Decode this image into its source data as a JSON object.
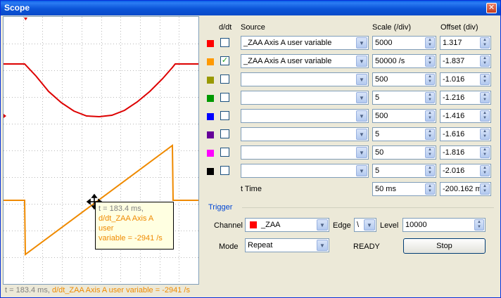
{
  "window": {
    "title": "Scope",
    "close_glyph": "✕"
  },
  "scope_tooltip": {
    "time": "t = 183.4 ms,",
    "value_line1": "d/dt_ZAA Axis A user",
    "value_line2": "variable = -2941 /s"
  },
  "status": {
    "time": "t = 183.4 ms,",
    "value": "d/dt_ZAA Axis A user variable = -2941 /s"
  },
  "headers": {
    "ddt": "d/dt",
    "source": "Source",
    "scale": "Scale (/div)",
    "offset": "Offset (div)"
  },
  "channels": [
    {
      "color": "#ff0000",
      "checked": false,
      "source": "_ZAA Axis A user variable",
      "scale": "5000",
      "offset": "1.317"
    },
    {
      "color": "#ff9900",
      "checked": true,
      "source": "_ZAA Axis A user variable",
      "scale": "50000 /s",
      "offset": "-1.837"
    },
    {
      "color": "#999900",
      "checked": false,
      "source": "",
      "scale": "500",
      "offset": "-1.016"
    },
    {
      "color": "#009900",
      "checked": false,
      "source": "",
      "scale": "5",
      "offset": "-1.216"
    },
    {
      "color": "#0000ff",
      "checked": false,
      "source": "",
      "scale": "500",
      "offset": "-1.416"
    },
    {
      "color": "#660099",
      "checked": false,
      "source": "",
      "scale": "5",
      "offset": "-1.616"
    },
    {
      "color": "#ff00ff",
      "checked": false,
      "source": "",
      "scale": "50",
      "offset": "-1.816"
    },
    {
      "color": "#000000",
      "checked": false,
      "source": "",
      "scale": "5",
      "offset": "-2.016"
    }
  ],
  "time_row": {
    "label": "t Time",
    "scale": "50 ms",
    "offset": "-200.162 m"
  },
  "trigger": {
    "title": "Trigger",
    "channel_label": "Channel",
    "channel_value": "_ZAA",
    "channel_color": "#ff0000",
    "edge_label": "Edge",
    "edge_value": "\\",
    "level_label": "Level",
    "level_value": "10000",
    "mode_label": "Mode",
    "mode_value": "Repeat",
    "state": "READY",
    "stop_label": "Stop"
  },
  "icons": {
    "combo_arrow": "chevron-down-icon",
    "spin": "spin-updown-icon",
    "cursor": "move-cursor-icon",
    "check": "✓"
  },
  "colors": {
    "trace_red": "#dd0000",
    "trace_orange": "#ef8a00",
    "grid": "#b8b8b8"
  }
}
